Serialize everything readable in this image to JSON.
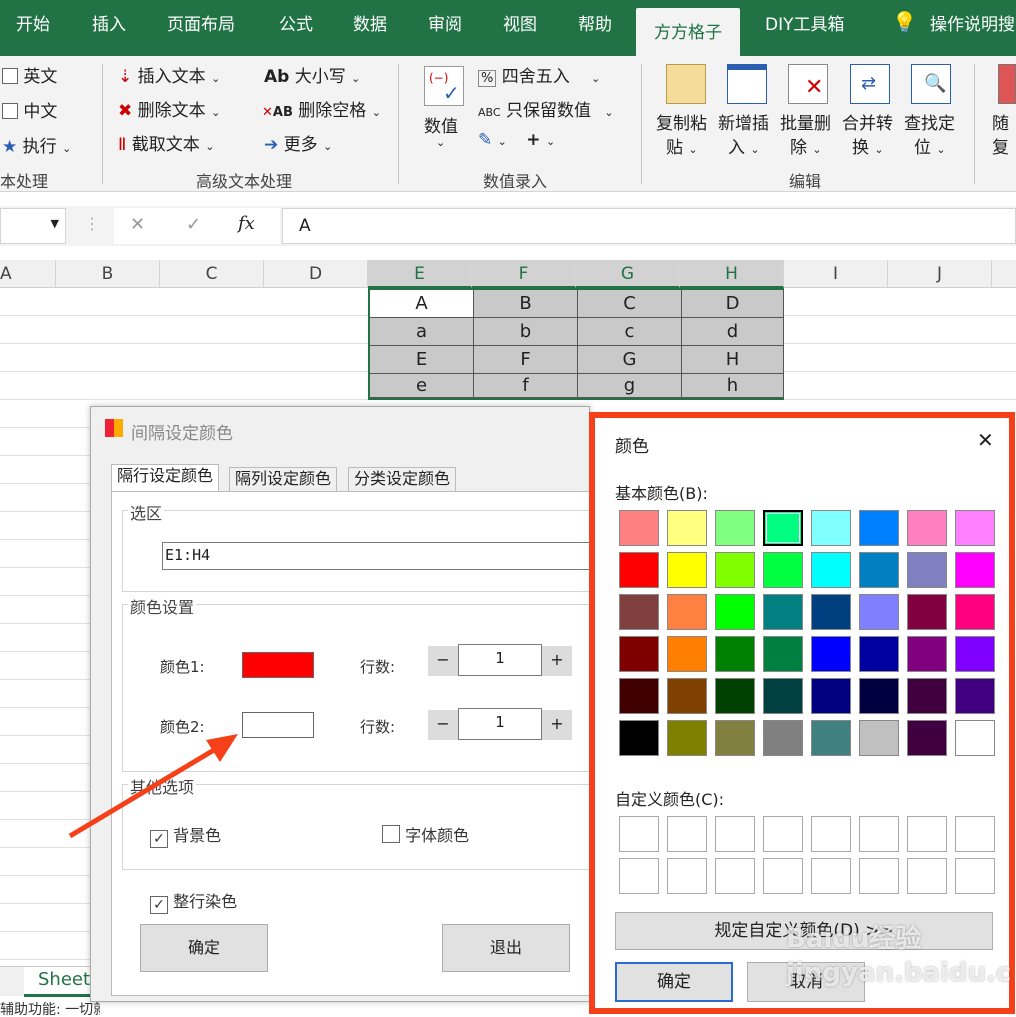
{
  "ribbon": {
    "tabs": [
      "开始",
      "插入",
      "页面布局",
      "公式",
      "数据",
      "审阅",
      "视图",
      "帮助",
      "方方格子",
      "DIY工具箱",
      "操作说明搜"
    ],
    "active_tab": "方方格子",
    "text_group": {
      "items": [
        "英文",
        "中文",
        "执行"
      ],
      "label": "本处理"
    },
    "adv_text": {
      "col1": [
        "插入文本",
        "删除文本",
        "截取文本"
      ],
      "col2": [
        "大小写",
        "删除空格",
        "更多"
      ],
      "label": "高级文本处理"
    },
    "numeric": {
      "big": "数值",
      "col": [
        "四舍五入",
        "只保留数值"
      ],
      "plus": "+",
      "label": "数值录入"
    },
    "edit": {
      "buttons": [
        [
          "复制粘",
          "贴"
        ],
        [
          "新增插",
          "入"
        ],
        [
          "批量删",
          "除"
        ],
        [
          "合并转",
          "换"
        ],
        [
          "查找定",
          "位"
        ]
      ],
      "label": "编辑"
    },
    "cut": [
      "随",
      "复"
    ]
  },
  "formula_bar": {
    "fx": "fx",
    "cancel": "✕",
    "enter": "✓",
    "value": "A"
  },
  "columns": [
    "A",
    "B",
    "C",
    "D",
    "E",
    "F",
    "G",
    "H",
    "I",
    "J"
  ],
  "cells": [
    [
      "A",
      "B",
      "C",
      "D"
    ],
    [
      "a",
      "b",
      "c",
      "d"
    ],
    [
      "E",
      "F",
      "G",
      "H"
    ],
    [
      "e",
      "f",
      "g",
      "h"
    ]
  ],
  "sheet_tab": "Sheet",
  "status": "辅助功能: 一切就绪",
  "dialog1": {
    "title": "间隔设定颜色",
    "tabs": [
      "隔行设定颜色",
      "隔列设定颜色",
      "分类设定颜色"
    ],
    "range_group": "选区",
    "range_value": "E1:H4",
    "color_group": "颜色设置",
    "color1_label": "颜色1:",
    "color1": "#ff0000",
    "color2_label": "颜色2:",
    "color2": "#ffffff",
    "rows_label": "行数:",
    "rows1": "1",
    "rows2": "1",
    "minus": "−",
    "plus": "+",
    "other_group": "其他选项",
    "bg_label": "背景色",
    "bg_checked": true,
    "font_label": "字体颜色",
    "font_checked": false,
    "fullrow_label": "整行染色",
    "fullrow_checked": true,
    "ok": "确定",
    "exit": "退出"
  },
  "dialog2": {
    "title": "颜色",
    "close": "✕",
    "basic_label": "基本颜色(B):",
    "basic_colors": [
      [
        "#ff8080",
        "#ffff80",
        "#80ff80",
        "#00ff80",
        "#80ffff",
        "#0080ff",
        "#ff80c0",
        "#ff80ff"
      ],
      [
        "#ff0000",
        "#ffff00",
        "#80ff00",
        "#00ff40",
        "#00ffff",
        "#0080c0",
        "#8080c0",
        "#ff00ff"
      ],
      [
        "#804040",
        "#ff8040",
        "#00ff00",
        "#008080",
        "#004080",
        "#8080ff",
        "#800040",
        "#ff0080"
      ],
      [
        "#800000",
        "#ff8000",
        "#008000",
        "#008040",
        "#0000ff",
        "#0000a0",
        "#800080",
        "#8000ff"
      ],
      [
        "#400000",
        "#804000",
        "#004000",
        "#004040",
        "#000080",
        "#000040",
        "#400040",
        "#400080"
      ],
      [
        "#000000",
        "#808000",
        "#808040",
        "#808080",
        "#408080",
        "#c0c0c0",
        "#400040",
        "#ffffff"
      ]
    ],
    "selected": [
      0,
      3
    ],
    "custom_label": "自定义颜色(C):",
    "define_btn": "规定自定义颜色(D) >>",
    "ok": "确定",
    "cancel": "取消"
  },
  "watermark": "Baidu经验 jingyan.baidu.com"
}
